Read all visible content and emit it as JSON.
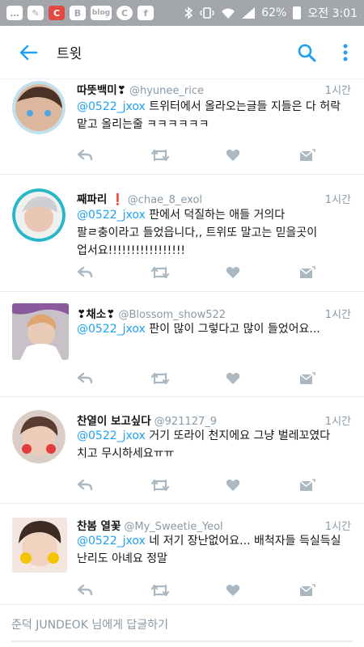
{
  "status_bar": {
    "icons": [
      "message-icon",
      "notification-icon",
      "c-app-icon",
      "b-app-icon",
      "blog-app-icon",
      "c-round-app-icon",
      "facebook-icon"
    ],
    "icon_glyphs": [
      "…",
      "✎",
      "C",
      "B",
      "blog",
      "C",
      "f"
    ],
    "battery": "62%",
    "time": "오전 3:01"
  },
  "app_bar": {
    "title": "트윗",
    "accent_color": "#1da1f2"
  },
  "tweets": [
    {
      "name": "따뜻백미❣",
      "handle": "@hyunee_rice",
      "time": "1시간",
      "mention": "@0522_jxox",
      "text_1": " 트위터에서 올라오는글들 지들은 다 허락",
      "text_2": "맡고 올리는줄 ㅋㅋㅋㅋㅋㅋ"
    },
    {
      "name": "째파리 ❗",
      "handle": "@chae_8_exol",
      "time": "1시간",
      "mention": "@0522_jxox",
      "text_1": " 판에서 덕질하는 애들 거의다",
      "text_2": "팔ㄹ충이라고 들었읍니다,, 트위또 말고는 믿을곳이",
      "text_3": "업서요!!!!!!!!!!!!!!!!!"
    },
    {
      "name": "❣채소❣",
      "handle": "@Blossom_show522",
      "time": "1시간",
      "mention": "@0522_jxox",
      "text_1": " 판이 많이 그렇다고 많이 들었어요..."
    },
    {
      "name": "찬열이 보고싶다",
      "handle": "@921127_9",
      "time": "1시간",
      "mention": "@0522_jxox",
      "text_1": " 거기 또라이 천지에요 그냥 벌레꼬였다",
      "text_2": "치고 무시하세요ㅠㅠ"
    },
    {
      "name": "찬봄 열꽃",
      "handle": "@My_Sweetie_Yeol",
      "time": "1시간",
      "mention": "@0522_jxox",
      "text_1": " 네 저기 장난없어요... 배척자들 득실득실",
      "text_2": "난리도 아녜요 정말"
    }
  ],
  "reply_bar": {
    "placeholder": "준덕 JUNDEOK 님에게 답글하기"
  }
}
